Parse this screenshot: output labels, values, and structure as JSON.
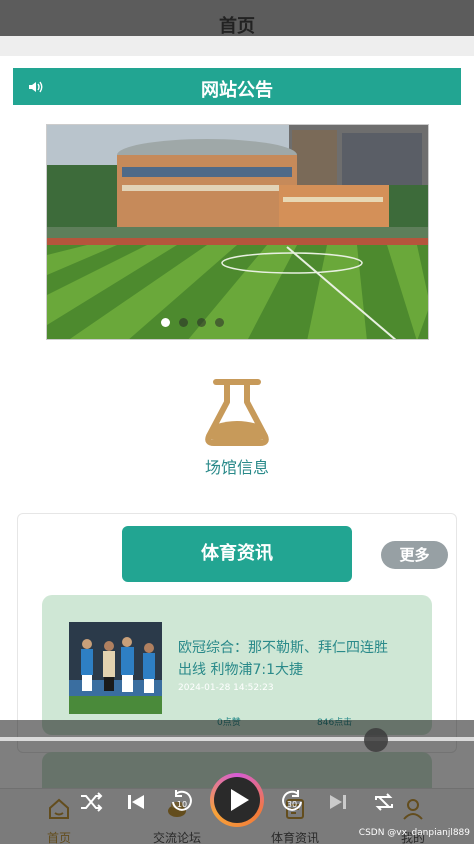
{
  "header": {
    "title": "首页"
  },
  "notice": {
    "title": "网站公告",
    "icon": "speaker-icon"
  },
  "banner": {
    "dots": 4,
    "active_index": 0
  },
  "venue": {
    "label": "场馆信息",
    "icon": "flask-icon",
    "icon_color": "#c79a5a"
  },
  "news": {
    "section_title": "体育资讯",
    "more_label": "更多",
    "items": [
      {
        "headline": "欧冠综合：那不勒斯、拜仁四连胜出线 利物浦7:1大捷",
        "time": "2024-01-28 14:52:23",
        "likes": "0点赞",
        "views": "846点击"
      }
    ]
  },
  "tabbar": {
    "items": [
      {
        "label": "首页",
        "icon": "home-icon",
        "active": true
      },
      {
        "label": "交流论坛",
        "icon": "forum-icon",
        "active": false
      },
      {
        "label": "体育资讯",
        "icon": "news-icon",
        "active": false
      },
      {
        "label": "我的",
        "icon": "user-icon",
        "active": false
      }
    ]
  },
  "player": {
    "controls": [
      "shuffle-icon",
      "previous-icon",
      "rewind-10-icon",
      "play-icon",
      "forward-30-icon",
      "next-icon",
      "repeat-icon"
    ],
    "progress": 0.78
  },
  "watermark": "CSDN @vx_danpianjl889",
  "colors": {
    "accent": "#22a592",
    "card_bg": "#cfe7d5",
    "active_tab": "#c79a3b"
  }
}
